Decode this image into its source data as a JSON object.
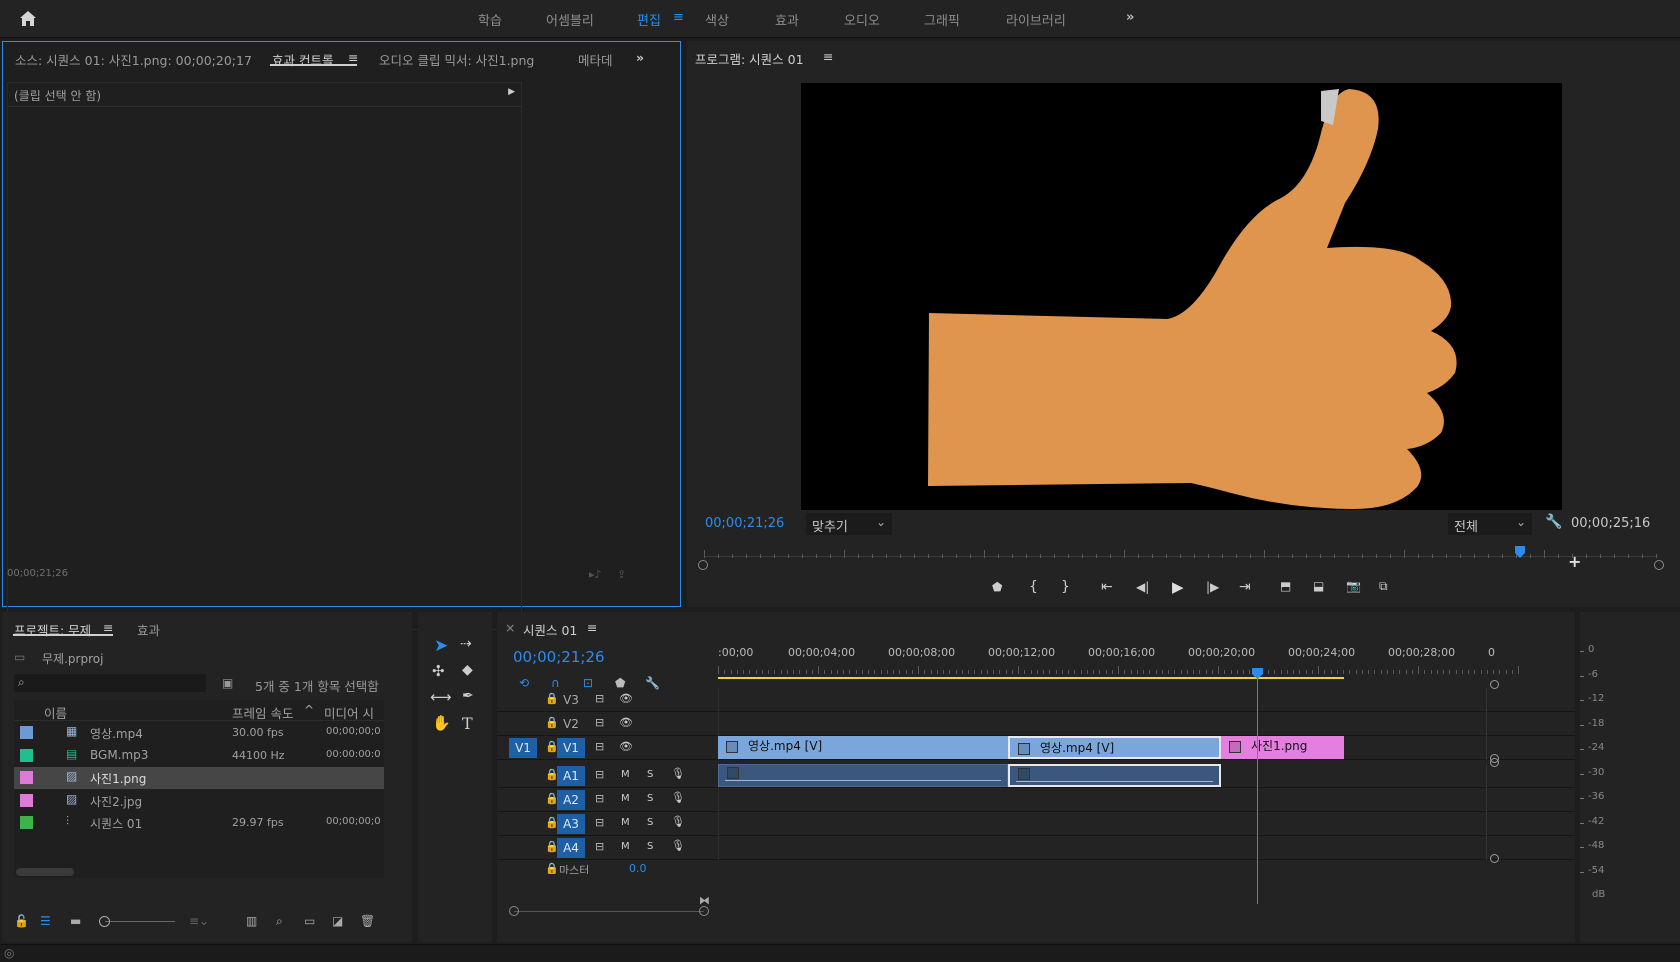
{
  "topbar": {
    "workspaces": [
      "학습",
      "어셈블리",
      "편집",
      "색상",
      "효과",
      "오디오",
      "그래픽",
      "라이브러리"
    ],
    "active": "편집",
    "overflow_icon": "double-chevron-right-icon"
  },
  "effect_controls": {
    "tab_source": "소스: 시퀀스 01: 사진1.png: 00;00;20;17",
    "tab_effects": "효과 컨트롤",
    "tab_audio_mixer": "오디오 클립 믹서: 사진1.png",
    "tab_metadata": "메타데",
    "no_clip": "(클립 선택 안 함)",
    "timecode": "00;00;21;26"
  },
  "program_monitor": {
    "title": "프로그램: 시퀀스 01",
    "current_time": "00;00;21;26",
    "fit": "맞추기",
    "quality": "전체",
    "duration": "00;00;25;16",
    "playhead_fraction": 0.855
  },
  "project": {
    "tab_project": "프로젝트: 무제",
    "tab_effects": "효과",
    "file": "무제.prproj",
    "selection_info": "5개 중 1개 항목 선택함",
    "col_name": "이름",
    "col_fps": "프레임 속도",
    "col_media": "미디어 시",
    "items": [
      {
        "color": "#6e9ad4",
        "icon": "video-clip-icon",
        "name": "영상.mp4",
        "fps": "30.00 fps",
        "tc": "00;00;00;0",
        "selected": false
      },
      {
        "color": "#1fbf8f",
        "icon": "audio-clip-icon",
        "name": "BGM.mp3",
        "fps": "44100 Hz",
        "tc": "00:00:00:0",
        "selected": false
      },
      {
        "color": "#e07ad8",
        "icon": "image-icon",
        "name": "사진1.png",
        "fps": "",
        "tc": "",
        "selected": true
      },
      {
        "color": "#e07ad8",
        "icon": "image-icon",
        "name": "사진2.jpg",
        "fps": "",
        "tc": "",
        "selected": false
      },
      {
        "color": "#3fb34a",
        "icon": "sequence-icon",
        "name": "시퀀스 01",
        "fps": "29.97 fps",
        "tc": "00;00;00;0",
        "selected": false
      }
    ]
  },
  "timeline": {
    "tab": "시퀀스 01",
    "timecode": "00;00;21;26",
    "ruler": [
      ":00;00",
      "00;00;04;00",
      "00;00;08;00",
      "00;00;12;00",
      "00;00;16;00",
      "00;00;20;00",
      "00;00;24;00",
      "00;00;28;00",
      "0"
    ],
    "video_tracks": [
      "V3",
      "V2",
      "V1"
    ],
    "audio_tracks": [
      "A1",
      "A2",
      "A3",
      "A4"
    ],
    "source_patch_v": "V1",
    "master_label": "마스터",
    "master_value": "0.0",
    "clips_v1": [
      {
        "name": "영상.mp4 [V]",
        "color": "#7aa6dc"
      },
      {
        "name": "영상.mp4 [V]",
        "color": "#7aa6dc"
      },
      {
        "name": "사진1.png",
        "color": "#e47fe0"
      }
    ],
    "mute": "M",
    "solo": "S"
  },
  "meter": {
    "labels": [
      "0",
      "-6",
      "-12",
      "-18",
      "-24",
      "-30",
      "-36",
      "-42",
      "-48",
      "-54",
      "dB"
    ]
  },
  "colors": {
    "accent": "#2d8ceb",
    "skin": "#e0954f"
  }
}
